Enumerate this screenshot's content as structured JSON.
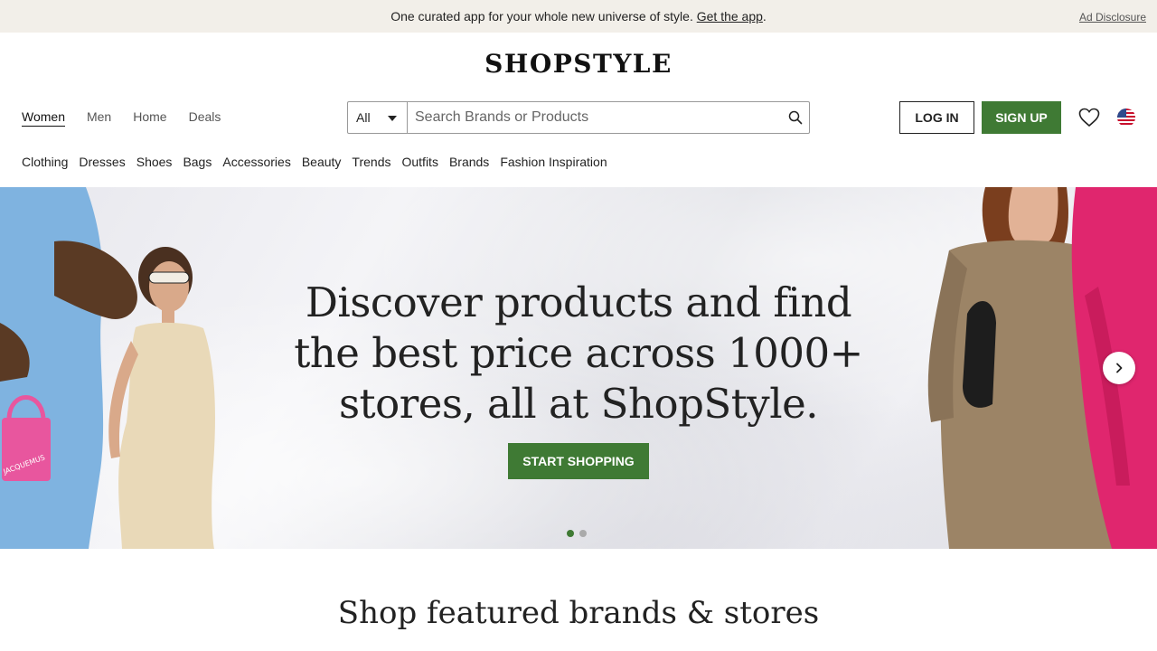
{
  "banner": {
    "text": "One curated app for your whole new universe of style.",
    "link": "Get the app",
    "suffix": ".",
    "ad_disclosure": "Ad Disclosure"
  },
  "logo": "SHOPSTYLE",
  "primary_nav": [
    "Women",
    "Men",
    "Home",
    "Deals"
  ],
  "primary_nav_active": "Women",
  "search": {
    "scope": "All",
    "placeholder": "Search Brands or Products"
  },
  "account": {
    "login": "LOG IN",
    "signup": "SIGN UP"
  },
  "category_nav": [
    "Clothing",
    "Dresses",
    "Shoes",
    "Bags",
    "Accessories",
    "Beauty",
    "Trends",
    "Outfits",
    "Brands",
    "Fashion Inspiration"
  ],
  "hero": {
    "headline_lines": [
      "Discover products and find",
      "the best price across 1000+",
      "stores, all at ShopStyle."
    ],
    "cta": "START SHOPPING",
    "bag_label": "JACQUEMUS",
    "slide_count": 2,
    "active_slide": 1
  },
  "section_title": "Shop featured brands & stores",
  "colors": {
    "accent": "#3f7a34",
    "banner_bg": "#f2efe9"
  },
  "icons": {
    "search": "search-icon",
    "heart": "heart-icon",
    "flag": "us-flag-icon",
    "next": "chevron-right-icon",
    "caret": "caret-down-icon"
  }
}
